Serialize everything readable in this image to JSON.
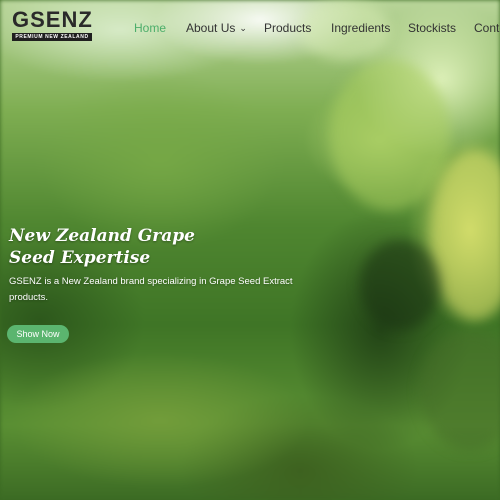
{
  "brand": {
    "name": "GSENZ",
    "tagline": "PREMIUM NEW ZEALAND"
  },
  "nav": {
    "items": [
      {
        "label": "Home",
        "active": true
      },
      {
        "label": "About Us",
        "has_dropdown": true
      },
      {
        "label": "Products"
      },
      {
        "label": "Ingredients"
      },
      {
        "label": "Stockists"
      },
      {
        "label": "Conte"
      }
    ]
  },
  "hero": {
    "title_line1": "New Zealand Grape",
    "title_line2": "Seed Expertise",
    "description": "GSENZ is a New Zealand brand specializing in Grape Seed Extract products.",
    "cta_label": "Show Now"
  },
  "colors": {
    "accent": "#4cae6a",
    "button": "#5bb56f",
    "nav_text": "#333333",
    "hero_text": "#ffffff"
  },
  "icons": {
    "dropdown": "chevron-down-icon"
  }
}
